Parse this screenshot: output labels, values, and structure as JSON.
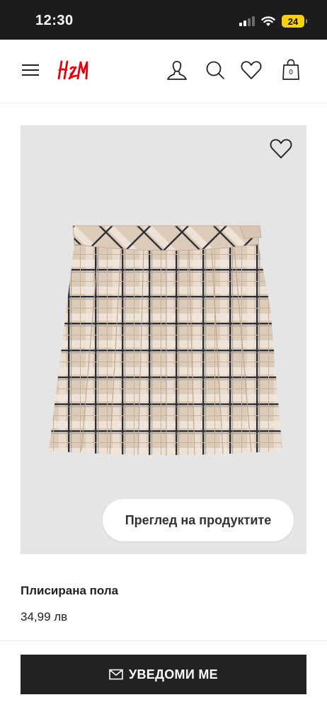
{
  "status_bar": {
    "time": "12:30",
    "battery_level": "24",
    "battery_color": "#f5d20c"
  },
  "header": {
    "logo_text": "H&M",
    "logo_color": "#e50010",
    "bag_count": "0",
    "icons": [
      "menu-icon",
      "account-icon",
      "search-icon",
      "heart-icon",
      "bag-icon"
    ]
  },
  "product": {
    "image_overview_label": "Преглед на продуктите",
    "name": "Плисирана пола",
    "price": "34,99 лв"
  },
  "actions": {
    "notify_label": "УВЕДОМИ МЕ",
    "notify_icon": "mail-icon"
  }
}
